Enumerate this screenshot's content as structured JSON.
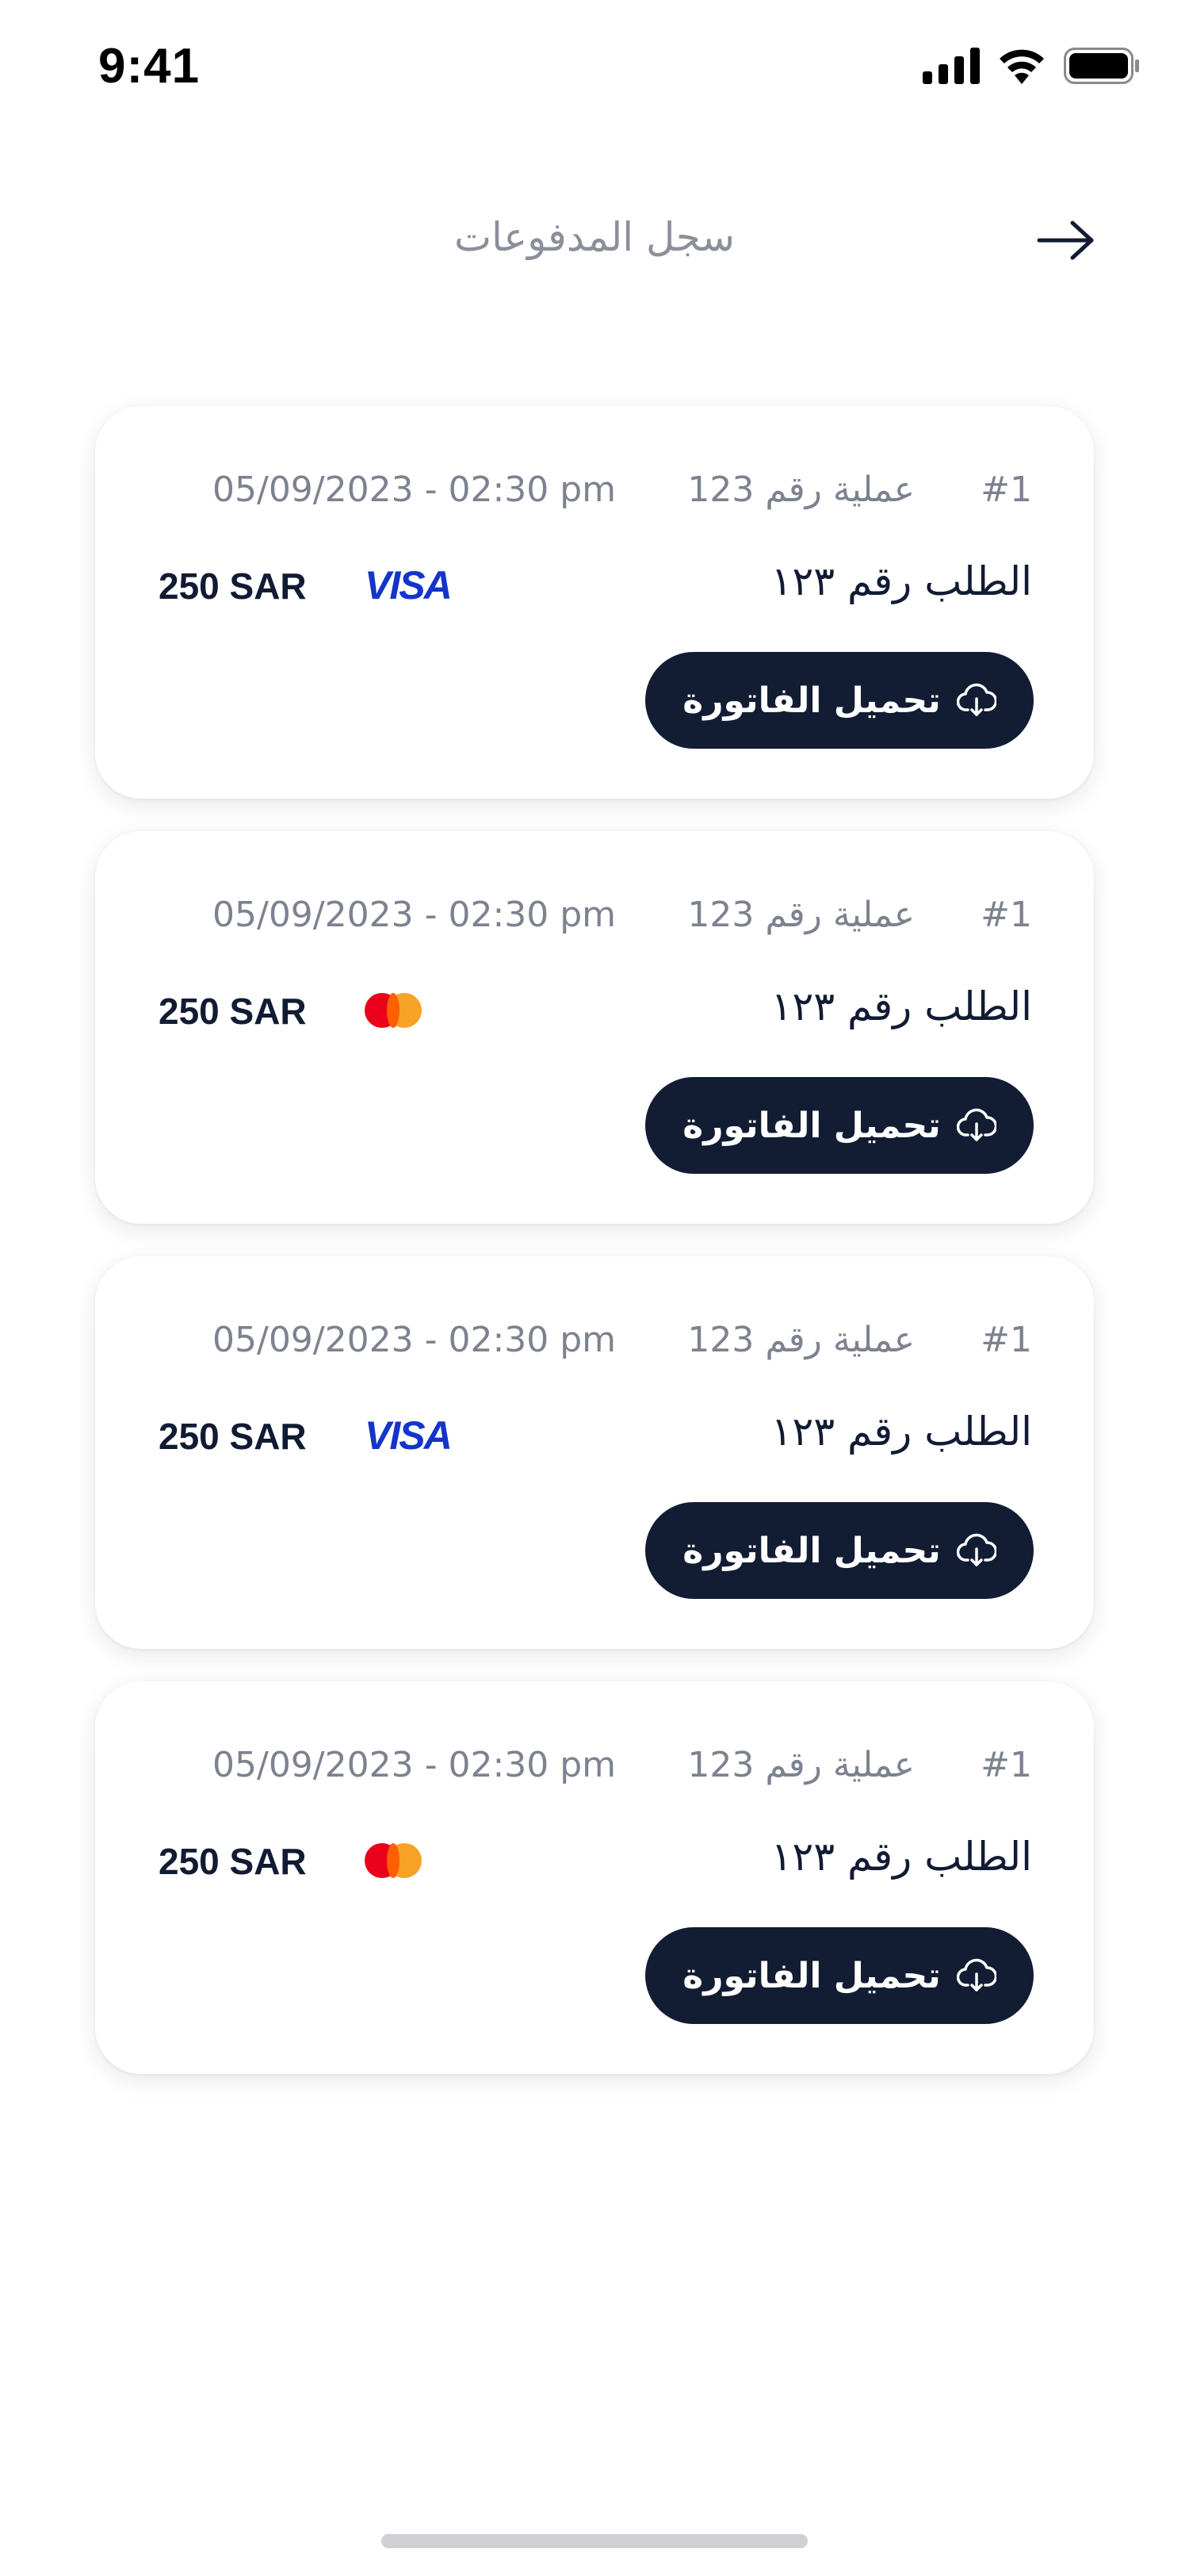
{
  "status_bar": {
    "time": "9:41"
  },
  "header": {
    "title": "سجل المدفوعات"
  },
  "transactions": [
    {
      "index": "#1",
      "operation": "عملية رقم 123",
      "datetime": "05/09/2023 - 02:30 pm",
      "order": "الطلب رقم ١٢٣",
      "amount": "250 SAR",
      "brand": "visa",
      "brand_label": "VISA",
      "download_label": "تحميل الفاتورة"
    },
    {
      "index": "#1",
      "operation": "عملية رقم 123",
      "datetime": "05/09/2023 - 02:30 pm",
      "order": "الطلب رقم ١٢٣",
      "amount": "250 SAR",
      "brand": "mastercard",
      "brand_label": "",
      "download_label": "تحميل الفاتورة"
    },
    {
      "index": "#1",
      "operation": "عملية رقم 123",
      "datetime": "05/09/2023 - 02:30 pm",
      "order": "الطلب رقم ١٢٣",
      "amount": "250 SAR",
      "brand": "visa",
      "brand_label": "VISA",
      "download_label": "تحميل الفاتورة"
    },
    {
      "index": "#1",
      "operation": "عملية رقم 123",
      "datetime": "05/09/2023 - 02:30 pm",
      "order": "الطلب رقم ١٢٣",
      "amount": "250 SAR",
      "brand": "mastercard",
      "brand_label": "",
      "download_label": "تحميل الفاتورة"
    }
  ],
  "colors": {
    "primary": "#121c33",
    "muted_text": "#7d8290",
    "visa_blue": "#1434cb",
    "mastercard_red": "#eb001b",
    "mastercard_orange": "#f79e1b"
  },
  "icons": {
    "back": "arrow-right-icon",
    "download": "cloud-download-icon",
    "signal": "cellular-signal-icon",
    "wifi": "wifi-icon",
    "battery": "battery-icon"
  }
}
